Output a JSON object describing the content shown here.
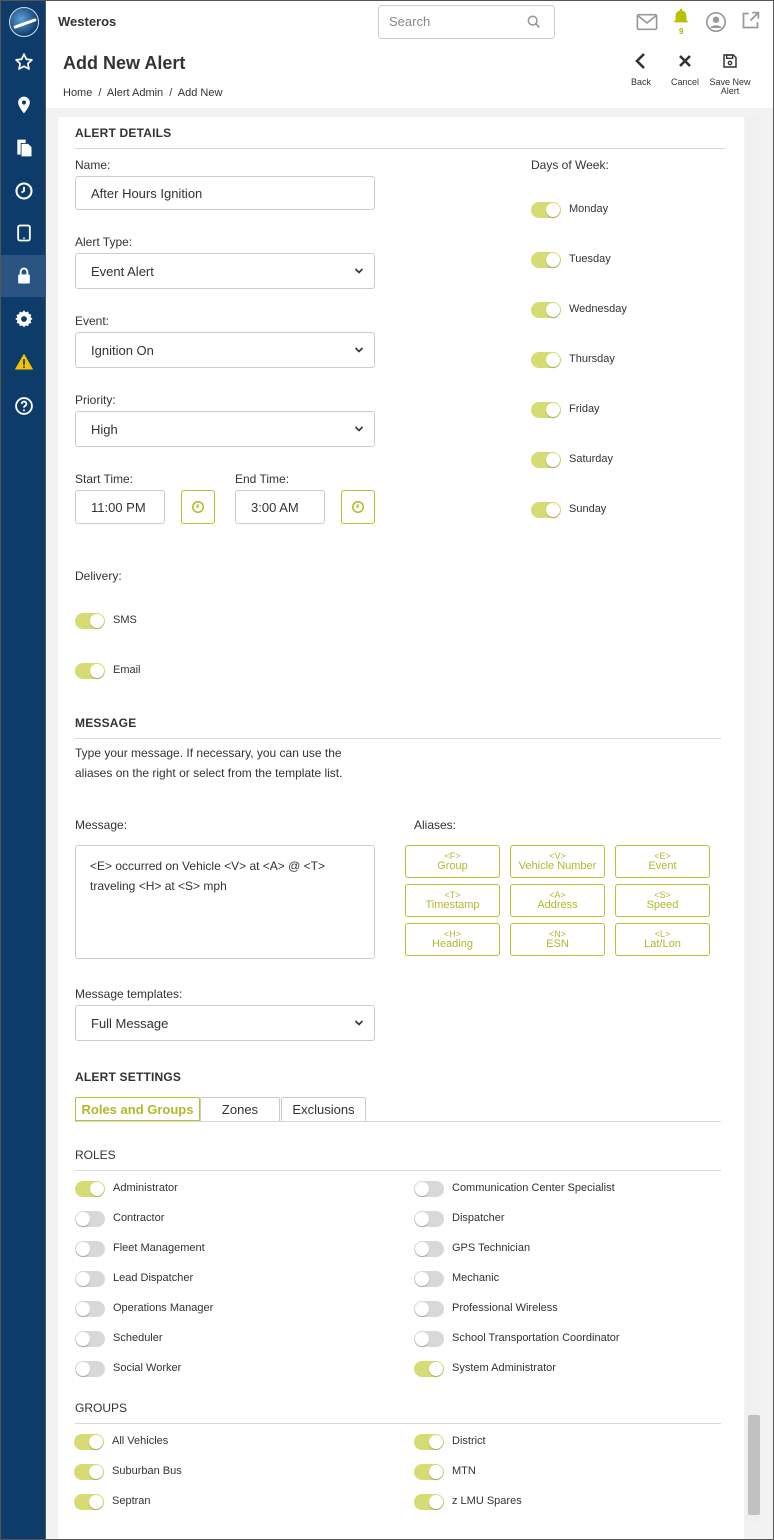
{
  "app": {
    "brand": "Westeros"
  },
  "search": {
    "placeholder": "Search"
  },
  "notifications": {
    "count": "9"
  },
  "page": {
    "title": "Add New Alert",
    "breadcrumbs": [
      "Home",
      "/",
      "Alert Admin",
      "/",
      "Add New"
    ]
  },
  "actions": {
    "back": "Back",
    "cancel": "Cancel",
    "save_line1": "Save New",
    "save_line2": "Alert"
  },
  "details": {
    "heading": "ALERT DETAILS",
    "name_label": "Name:",
    "name_value": "After Hours Ignition",
    "alert_type_label": "Alert Type:",
    "alert_type_value": "Event Alert",
    "event_label": "Event:",
    "event_value": "Ignition On",
    "priority_label": "Priority:",
    "priority_value": "High",
    "start_label": "Start Time:",
    "start_value": "11:00 PM",
    "end_label": "End Time:",
    "end_value": "3:00 AM",
    "days_label": "Days of Week:",
    "days": [
      {
        "label": "Monday",
        "on": true
      },
      {
        "label": "Tuesday",
        "on": true
      },
      {
        "label": "Wednesday",
        "on": true
      },
      {
        "label": "Thursday",
        "on": true
      },
      {
        "label": "Friday",
        "on": true
      },
      {
        "label": "Saturday",
        "on": true
      },
      {
        "label": "Sunday",
        "on": true
      }
    ],
    "delivery_label": "Delivery:",
    "delivery": [
      {
        "label": "SMS",
        "on": true
      },
      {
        "label": "Email",
        "on": true
      }
    ]
  },
  "message": {
    "heading": "MESSAGE",
    "intro_line1": "Type your message. If necessary, you can use the",
    "intro_line2": "aliases on the right or select from the template list.",
    "message_label": "Message:",
    "message_line1": "<E> occurred on Vehicle <V> at <A> @ <T>",
    "message_line2": "traveling <H> at <S> mph",
    "aliases_label": "Aliases:",
    "aliases": [
      {
        "code": "<F>",
        "label": "Group"
      },
      {
        "code": "<V>",
        "label": "Vehicle Number"
      },
      {
        "code": "<E>",
        "label": "Event"
      },
      {
        "code": "<T>",
        "label": "Timestamp"
      },
      {
        "code": "<A>",
        "label": "Address"
      },
      {
        "code": "<S>",
        "label": "Speed"
      },
      {
        "code": "<H>",
        "label": "Heading"
      },
      {
        "code": "<N>",
        "label": "ESN"
      },
      {
        "code": "<L>",
        "label": "Lat/Lon"
      }
    ],
    "templates_label": "Message templates:",
    "templates_value": "Full Message"
  },
  "settings": {
    "heading": "ALERT SETTINGS",
    "tabs": [
      "Roles and Groups",
      "Zones",
      "Exclusions"
    ],
    "roles_heading": "ROLES",
    "roles_left": [
      {
        "label": "Administrator",
        "on": true
      },
      {
        "label": "Contractor",
        "on": false
      },
      {
        "label": "Fleet Management",
        "on": false
      },
      {
        "label": "Lead Dispatcher",
        "on": false
      },
      {
        "label": "Operations Manager",
        "on": false
      },
      {
        "label": "Scheduler",
        "on": false
      },
      {
        "label": "Social Worker",
        "on": false
      }
    ],
    "roles_right": [
      {
        "label": "Communication Center Specialist",
        "on": false
      },
      {
        "label": "Dispatcher",
        "on": false
      },
      {
        "label": "GPS Technician",
        "on": false
      },
      {
        "label": "Mechanic",
        "on": false
      },
      {
        "label": "Professional Wireless",
        "on": false
      },
      {
        "label": "School Transportation Coordinator",
        "on": false
      },
      {
        "label": "System Administrator",
        "on": true
      }
    ],
    "groups_heading": "GROUPS",
    "groups_left": [
      {
        "label": "All Vehicles",
        "on": true
      },
      {
        "label": "Suburban Bus",
        "on": true
      },
      {
        "label": "Septran",
        "on": true
      }
    ],
    "groups_right": [
      {
        "label": "District",
        "on": true
      },
      {
        "label": "MTN",
        "on": true
      },
      {
        "label": "z LMU Spares",
        "on": true
      }
    ]
  },
  "colors": {
    "sidebar": "#0d3c6a",
    "accent": "#b8c22e",
    "toggle_on": "#d6db74",
    "toggle_off": "#d8d8d8"
  }
}
